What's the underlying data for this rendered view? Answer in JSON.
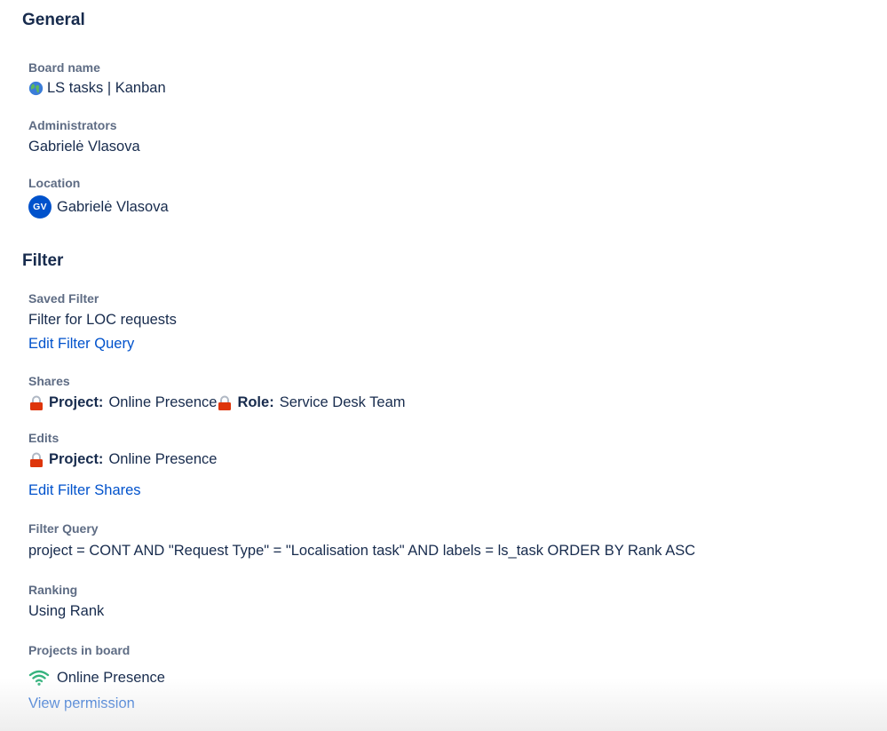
{
  "general": {
    "title": "General",
    "board_name": {
      "label": "Board name",
      "value": "LS tasks | Kanban",
      "icon": "globe-icon"
    },
    "administrators": {
      "label": "Administrators",
      "value": "Gabrielė Vlasova"
    },
    "location": {
      "label": "Location",
      "avatar_initials": "GV",
      "value": "Gabrielė Vlasova"
    }
  },
  "filter": {
    "title": "Filter",
    "saved_filter": {
      "label": "Saved Filter",
      "value": "Filter for LOC requests",
      "edit_link": "Edit Filter Query"
    },
    "shares": {
      "label": "Shares",
      "items": [
        {
          "key": "Project:",
          "value": "Online Presence"
        },
        {
          "key": "Role:",
          "value": "Service Desk Team"
        }
      ]
    },
    "edits": {
      "label": "Edits",
      "items": [
        {
          "key": "Project:",
          "value": "Online Presence"
        }
      ],
      "edit_link": "Edit Filter Shares"
    },
    "filter_query": {
      "label": "Filter Query",
      "value": "project = CONT AND \"Request Type\" = \"Localisation task\" AND labels = ls_task ORDER BY Rank ASC"
    },
    "ranking": {
      "label": "Ranking",
      "value": "Using Rank"
    },
    "projects_in_board": {
      "label": "Projects in board",
      "project": "Online Presence",
      "permission_link": "View permission"
    }
  },
  "colors": {
    "text": "#172b4d",
    "label": "#5e6c84",
    "link": "#0052cc",
    "avatar": "#0052cc",
    "lock": "#de350b",
    "wifi": "#36b37e"
  }
}
